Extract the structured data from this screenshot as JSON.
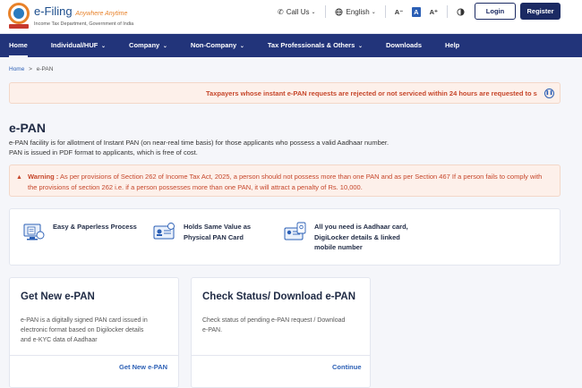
{
  "header": {
    "logo_title": "e-Filing",
    "logo_tagline": "Anywhere Anytime",
    "logo_subtitle": "Income Tax Department, Government of India",
    "call_us": "Call Us",
    "language": "English",
    "font_decrease": "A⁻",
    "font_normal": "A",
    "font_increase": "A⁺",
    "login": "Login",
    "register": "Register"
  },
  "nav": {
    "items": [
      {
        "label": "Home",
        "has_caret": false
      },
      {
        "label": "Individual/HUF",
        "has_caret": true
      },
      {
        "label": "Company",
        "has_caret": true
      },
      {
        "label": "Non-Company",
        "has_caret": true
      },
      {
        "label": "Tax Professionals & Others",
        "has_caret": true
      },
      {
        "label": "Downloads",
        "has_caret": false
      },
      {
        "label": "Help",
        "has_caret": false
      }
    ]
  },
  "breadcrumb": {
    "home": "Home",
    "separator": ">",
    "current": "e-PAN"
  },
  "notice": {
    "text": "Taxpayers whose instant e-PAN requests are rejected or not serviced within 24 hours are requested to s"
  },
  "page": {
    "title": "e-PAN",
    "description": "e-PAN facility is for allotment of Instant PAN (on near-real time basis) for those applicants who possess a valid Aadhaar number. PAN is issued in PDF format to applicants, which is free of cost."
  },
  "warning": {
    "label": "Warning :",
    "text": "As per provisions of Section 262 of Income Tax Act, 2025, a person should not possess more than one PAN and as per Section 467 If a person fails to comply with the provisions of section 262 i.e. if a person possesses more than one PAN, it will attract a penalty of Rs. 10,000."
  },
  "features": [
    {
      "icon": "paperless-icon",
      "text": "Easy & Paperless Process"
    },
    {
      "icon": "pan-card-icon",
      "text_line1": "Holds Same Value as",
      "text_line2": "Physical PAN Card"
    },
    {
      "icon": "aadhaar-digilocker-icon",
      "text_line1": "All you need is Aadhaar card,",
      "text_line2": "DigiLocker details & linked",
      "text_line3": "mobile number"
    }
  ],
  "cards": [
    {
      "title": "Get New e-PAN",
      "desc_line1": "e-PAN is a digitally signed PAN card issued in",
      "desc_line2": "electronic format based on Digilocker details",
      "desc_line3": "and e-KYC data of Aadhaar",
      "link": "Get New e-PAN"
    },
    {
      "title": "Check Status/ Download e-PAN",
      "desc_line1": "Check status of pending e-PAN request / Download",
      "desc_line2": "e-PAN.",
      "link": "Continue"
    }
  ],
  "colors": {
    "primary": "#22347a",
    "accent": "#2b5fb5",
    "warning": "#c6462a",
    "warning_bg": "#fdf0ea"
  }
}
